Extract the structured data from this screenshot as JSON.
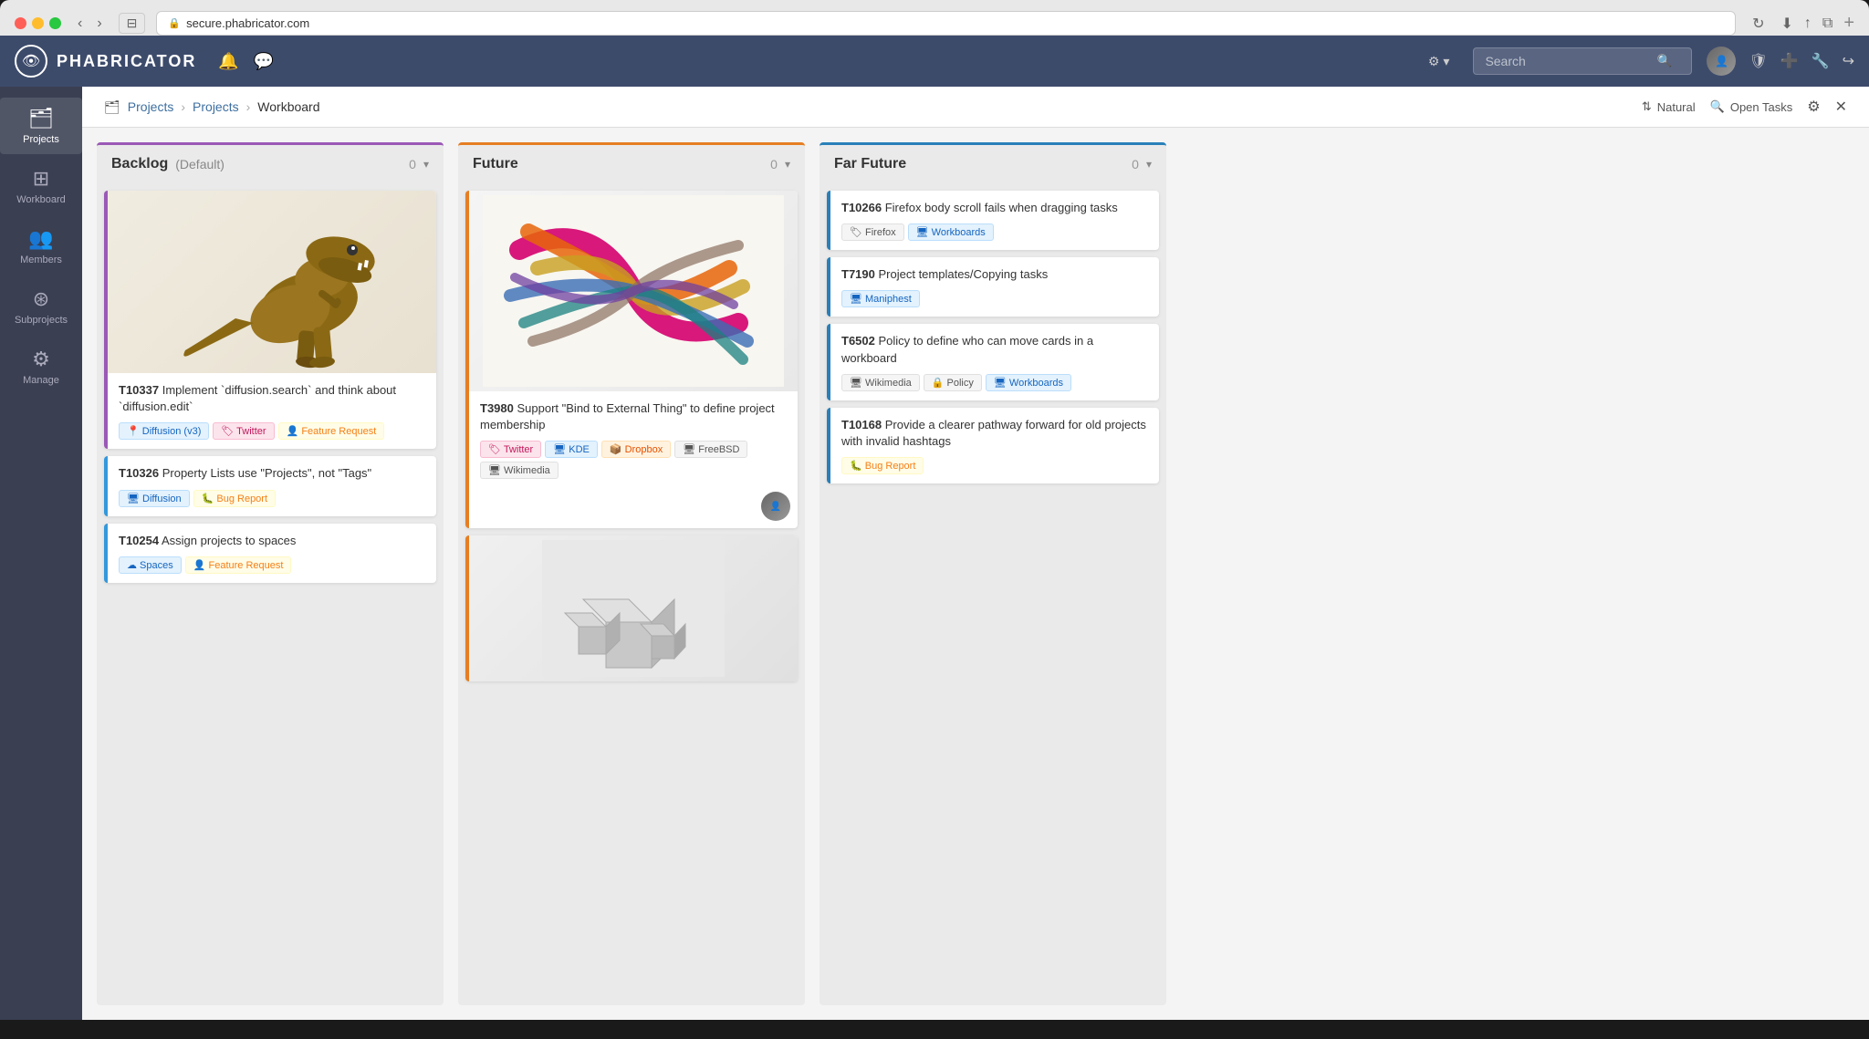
{
  "browser": {
    "url": "secure.phabricator.com",
    "new_tab_label": "+"
  },
  "navbar": {
    "logo_text": "PHABRICATOR",
    "search_placeholder": "Search",
    "gear_label": "⚙",
    "bell_label": "🔔",
    "chat_label": "💬",
    "avatar_alt": "User Avatar",
    "help_icon": "?",
    "plus_icon": "+",
    "wrench_icon": "🔧",
    "logout_icon": "→"
  },
  "sidebar": {
    "items": [
      {
        "id": "projects",
        "label": "Projects",
        "icon": "🗂"
      },
      {
        "id": "workboard",
        "label": "Workboard",
        "icon": "⊞"
      },
      {
        "id": "members",
        "label": "Members",
        "icon": "👥"
      },
      {
        "id": "subprojects",
        "label": "Subprojects",
        "icon": "⊛"
      },
      {
        "id": "manage",
        "label": "Manage",
        "icon": "⚙"
      }
    ]
  },
  "breadcrumb": {
    "icon": "🗂",
    "parts": [
      "Projects",
      "Projects",
      "Workboard"
    ]
  },
  "workboard_actions": {
    "sort_label": "Natural",
    "filter_label": "Open Tasks",
    "settings_icon": "⚙",
    "fullscreen_icon": "✕"
  },
  "columns": {
    "backlog": {
      "title": "Backlog",
      "subtitle": "(Default)",
      "count": "0",
      "cards": [
        {
          "id": "t10337",
          "task_id": "T10337",
          "title": "Implement `diffusion.search` and think about `diffusion.edit`",
          "has_image": true,
          "image_type": "dino",
          "tags": [
            {
              "label": "Diffusion (v3)",
              "type": "blue",
              "icon": "📍"
            },
            {
              "label": "Twitter",
              "type": "pink",
              "icon": "🏷"
            },
            {
              "label": "Feature Request",
              "type": "yellow",
              "icon": "👤"
            }
          ],
          "border": "purple"
        },
        {
          "id": "t10326",
          "task_id": "T10326",
          "title": "Property Lists use \"Projects\", not \"Tags\"",
          "has_image": false,
          "tags": [
            {
              "label": "Diffusion",
              "type": "blue",
              "icon": "🖥"
            },
            {
              "label": "Bug Report",
              "type": "yellow",
              "icon": "🐛"
            }
          ],
          "border": "blue"
        },
        {
          "id": "t10254",
          "task_id": "T10254",
          "title": "Assign projects to spaces",
          "has_image": false,
          "tags": [
            {
              "label": "Spaces",
              "type": "blue",
              "icon": "☁"
            },
            {
              "label": "Feature Request",
              "type": "yellow",
              "icon": "👤"
            }
          ],
          "border": "blue"
        }
      ]
    },
    "future": {
      "title": "Future",
      "count": "0",
      "cards": [
        {
          "id": "t3980",
          "task_id": "T3980",
          "title": "Support \"Bind to External Thing\" to define project membership",
          "has_image": true,
          "image_type": "knot",
          "tags": [
            {
              "label": "Twitter",
              "type": "pink",
              "icon": "🏷"
            },
            {
              "label": "KDE",
              "type": "blue",
              "icon": "🖥"
            },
            {
              "label": "Dropbox",
              "type": "orange",
              "icon": "📦"
            },
            {
              "label": "FreeBSD",
              "type": "gray",
              "icon": "🖥"
            },
            {
              "label": "Wikimedia",
              "type": "gray",
              "icon": "🖥"
            }
          ],
          "border": "orange",
          "has_avatar": true
        },
        {
          "id": "t_cube",
          "task_id": "",
          "title": "",
          "has_image": true,
          "image_type": "cube",
          "tags": [],
          "border": "orange"
        }
      ]
    },
    "far_future": {
      "title": "Far Future",
      "count": "0",
      "cards": [
        {
          "id": "t10266",
          "task_id": "T10266",
          "title": "Firefox body scroll fails when dragging tasks",
          "tags": [
            {
              "label": "Firefox",
              "type": "gray",
              "icon": "🏷"
            },
            {
              "label": "Workboards",
              "type": "blue",
              "icon": "🖥"
            }
          ]
        },
        {
          "id": "t7190",
          "task_id": "T7190",
          "title": "Project templates/Copying tasks",
          "tags": [
            {
              "label": "Maniphest",
              "type": "blue",
              "icon": "🖥"
            }
          ]
        },
        {
          "id": "t6502",
          "task_id": "T6502",
          "title": "Policy to define who can move cards in a workboard",
          "tags": [
            {
              "label": "Wikimedia",
              "type": "gray",
              "icon": "🖥"
            },
            {
              "label": "Policy",
              "type": "gray",
              "icon": "🔒"
            },
            {
              "label": "Workboards",
              "type": "blue",
              "icon": "🖥"
            }
          ]
        },
        {
          "id": "t10168",
          "task_id": "T10168",
          "title": "Provide a clearer pathway forward for old projects with invalid hashtags",
          "tags": [
            {
              "label": "Bug Report",
              "type": "yellow",
              "icon": "🐛"
            }
          ]
        }
      ]
    }
  }
}
